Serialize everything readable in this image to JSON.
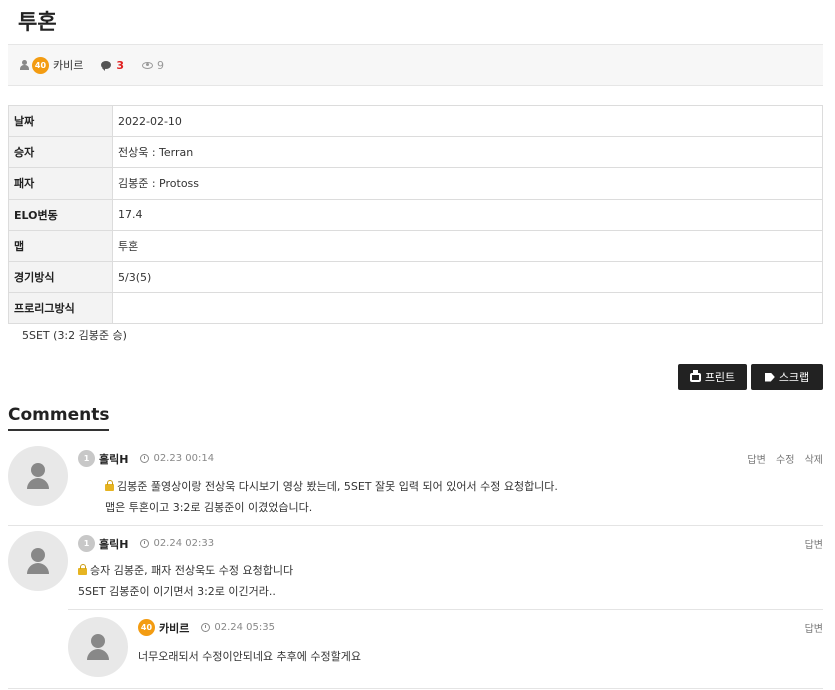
{
  "post": {
    "title": "투혼",
    "author_level": "40",
    "author": "카비르",
    "comment_count": "3",
    "view_count": "9"
  },
  "info": [
    {
      "key": "날짜",
      "value": "2022-02-10"
    },
    {
      "key": "승자",
      "value": "전상욱 : Terran"
    },
    {
      "key": "패자",
      "value": "김봉준 : Protoss"
    },
    {
      "key": "ELO변동",
      "value": "17.4"
    },
    {
      "key": "맵",
      "value": "투혼"
    },
    {
      "key": "경기방식",
      "value": "5/3(5)"
    },
    {
      "key": "프로리그방식",
      "value": ""
    }
  ],
  "result_text": "5SET (3:2 김봉준 승)",
  "buttons": {
    "print": "프린트",
    "scrap": "스크랩"
  },
  "comments_heading": "Comments",
  "comments": [
    {
      "level": "1",
      "name": "홀릭H",
      "time": "02.23 00:14",
      "line1": "김봉준 풀영상이랑 전상욱 다시보기 영상 봤는데, 5SET 잘못 입력 되어 있어서 수정 요청합니다.",
      "line2": "맵은 투혼이고 3:2로 김봉준이 이겼었습니다.",
      "actions": [
        "답변",
        "수정",
        "삭제"
      ]
    },
    {
      "level": "1",
      "name": "홀릭H",
      "time": "02.24 02:33",
      "line1": "승자 김봉준, 패자 전상욱도 수정 요청합니다",
      "line2": "5SET 김봉준이 이기면서 3:2로 이긴거라..",
      "actions": [
        "답변"
      ]
    },
    {
      "level": "40",
      "name": "카비르",
      "time": "02.24 05:35",
      "line1": "너무오래되서 수정이안되네요 추후에 수정할게요",
      "actions": [
        "답변"
      ]
    }
  ]
}
